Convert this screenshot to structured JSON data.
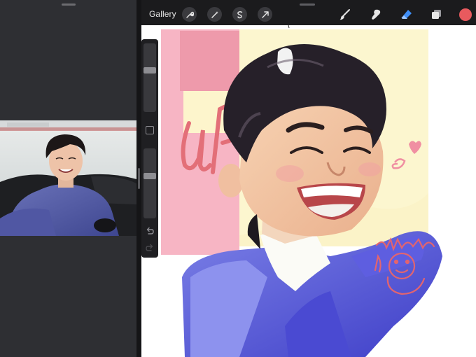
{
  "left_pane": {
    "reference_photo": {
      "content": "photo"
    }
  },
  "toolbar": {
    "gallery_label": "Gallery",
    "left_tools": [
      "wrench-icon",
      "magic-wand-icon",
      "selection-icon",
      "transform-arrow-icon"
    ],
    "right_tools": [
      "brush-icon",
      "smudge-icon",
      "eraser-icon",
      "layers-icon"
    ],
    "active_tool": "eraser-icon",
    "current_color": "#e85a5e"
  },
  "sidebar": {
    "brush_size": 0.62,
    "opacity": 0.62,
    "undo": "undo-arrow-icon",
    "redo": "redo-arrow-icon"
  },
  "colors": {
    "accent": "#3e8ef7",
    "canvas_bg": "#ffffff",
    "toolbar_bg": "#1b1b1d",
    "panel_bg": "#2e2f33"
  }
}
